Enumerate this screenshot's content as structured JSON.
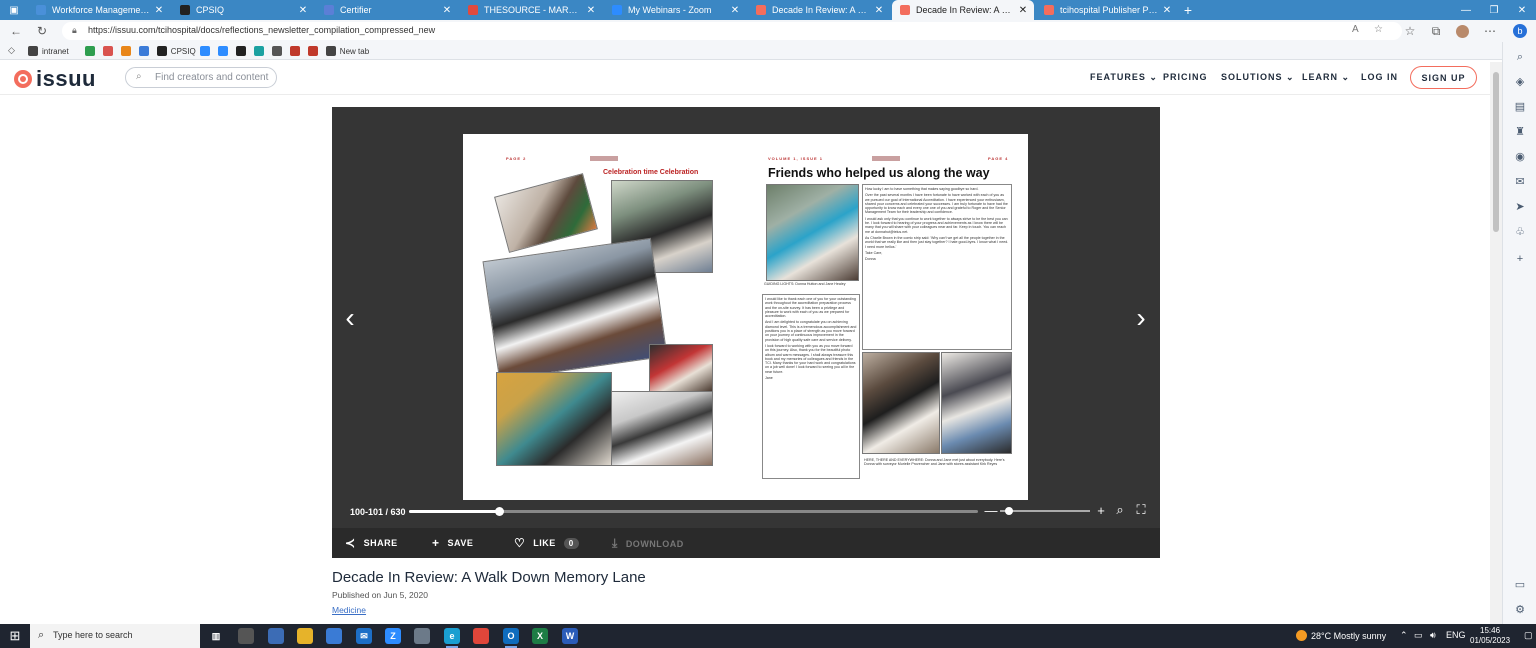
{
  "browser": {
    "tabs": [
      {
        "label": "Workforce Management Softwa",
        "favicon_color": "#4a90d9"
      },
      {
        "label": "CPSIQ",
        "favicon_color": "#222222"
      },
      {
        "label": "Certifier",
        "favicon_color": "#5b7fd6"
      },
      {
        "label": "THESOURCE - MARCH 2023 (3) |",
        "favicon_color": "#e04a3f"
      },
      {
        "label": "My Webinars - Zoom",
        "favicon_color": "#2d8cff"
      },
      {
        "label": "Decade In Review: A Walk Down",
        "favicon_color": "#f36d5d"
      },
      {
        "label": "Decade In Review: A Walk Down",
        "favicon_color": "#f36d5d"
      },
      {
        "label": "tcihospital Publisher Publicatio",
        "favicon_color": "#f36d5d"
      }
    ],
    "new_tab_symbol": "+",
    "url": "https://issuu.com/tcihospital/docs/reflections_newsletter_compilation_compressed_new",
    "bookmarks": [
      {
        "label": "intranet",
        "icon_color": "#444444"
      },
      {
        "label": "",
        "icon_color": "#2e9e4f"
      },
      {
        "label": "",
        "icon_color": "#d9534f"
      },
      {
        "label": "",
        "icon_color": "#e8861a"
      },
      {
        "label": "",
        "icon_color": "#3b7bd8"
      },
      {
        "label": "CPSIQ",
        "icon_color": "#222222"
      },
      {
        "label": "",
        "icon_color": "#2d8cff"
      },
      {
        "label": "",
        "icon_color": "#2d8cff"
      },
      {
        "label": "",
        "icon_color": "#222222"
      },
      {
        "label": "",
        "icon_color": "#1ba1a1"
      },
      {
        "label": "",
        "icon_color": "#555555"
      },
      {
        "label": "",
        "icon_color": "#c0392b"
      },
      {
        "label": "",
        "icon_color": "#c0392b"
      },
      {
        "label": "New tab",
        "icon_color": "#444444"
      }
    ]
  },
  "issuu": {
    "logo_text": "issuu",
    "search_placeholder": "Find creators and content",
    "menu": {
      "features": "FEATURES",
      "pricing": "PRICING",
      "solutions": "SOLUTIONS",
      "learn": "LEARN",
      "login": "LOG IN",
      "signup": "SIGN UP"
    }
  },
  "reader": {
    "page_count_label": "100-101 / 630",
    "progress_fraction": 0.159,
    "zoom_fraction": 0.1,
    "actions": {
      "share": "SHARE",
      "save": "SAVE",
      "like": "LIKE",
      "like_count": "0",
      "download": "DOWNLOAD"
    },
    "spread": {
      "left_page_label": "PAGE 2",
      "left_title": "Celebration time Celebration",
      "right_volume": "VOLUME 1, ISSUE 1",
      "right_page_label": "PAGE 4",
      "right_title": "Friends who helped us along the way",
      "right_caption_1": "GUIDING LIGHTS: Donna Hutton and Jane Healey",
      "right_caption_2": "HERE, THERE AND EVERYWHERE: Donna and Jane met just about everybody. Here's Donna with surveyor Murielle Provencher and Jane with stores assistant Kirk Reyes",
      "col_left": [
        "I would like to thank each one of you for your outstanding work throughout the accreditation preparation process and the on-site survey. It has been a privilege and pleasure to work with each of you as we prepared for accreditation.",
        "And I am delighted to congratulate you on achieving diamond level. This is a tremendous accomplishment and positions you in a place of strength as you move forward on your journey of continuous improvement in the provision of high quality safe care and service delivery.",
        "I look forward to working with you as you move forward on this journey. Also, thank you for the beautiful photo album and warm messages. I shall always treasure this book and my memories of colleagues and friends in the TCI. Many thanks for your hard work and congratulations on a job well done! I look forward to seeing you all in the near future.",
        "Jane"
      ],
      "col_right": [
        "How lucky I am to have something that makes saying goodbye so hard.",
        "Over the past several months I have been fortunate to have worked with each of you as we pursued our goal of International Accreditation. I have experienced your enthusiasm, shared your concerns and celebrated your successes. I am truly fortunate to have had the opportunity to know each and every one one of you and grateful to Roger and the Senior Management Team for their leadership and confidence.",
        "I would ask only that you continue to work together to always strive to be the best you can be. I look forward to hearing of your progress and achievements as I know there will be many that you will share with your colleagues near and far. Keep in touch. You can reach me at donnahut@telus.net.",
        "As Charlie Brown in the comic strip said: 'Why can't we get all the people together in the world that we really like and then just stay together? I hate good-byes. I know what I need. I need more hellos.'",
        "Take Care,",
        "Donna"
      ]
    }
  },
  "document": {
    "title": "Decade In Review: A Walk Down Memory Lane",
    "published": "Published on Jun 5, 2020",
    "category": "Medicine"
  },
  "taskbar": {
    "search_placeholder": "Type here to search",
    "weather": "28°C  Mostly sunny",
    "language": "ENG",
    "time": "15:46",
    "date": "01/05/2023"
  }
}
